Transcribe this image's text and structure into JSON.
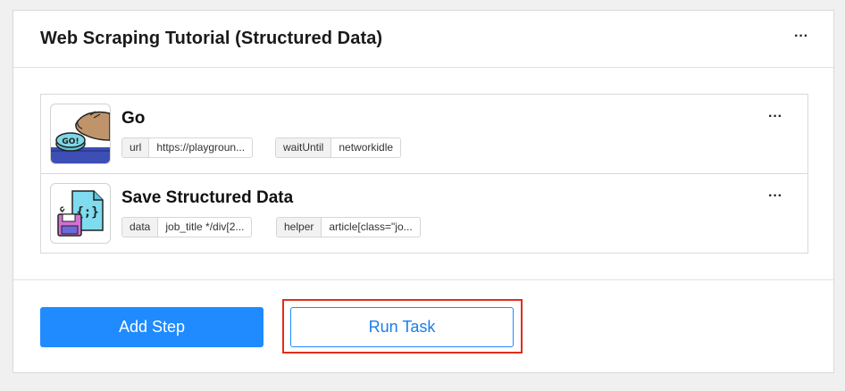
{
  "card": {
    "title": "Web Scraping Tutorial (Structured Data)",
    "menu_label": "···"
  },
  "steps": [
    {
      "title": "Go",
      "icon": "go-button-icon",
      "menu_label": "···",
      "params": [
        {
          "key": "url",
          "value": "https://playgroun..."
        },
        {
          "key": "waitUntil",
          "value": "networkidle"
        }
      ]
    },
    {
      "title": "Save Structured Data",
      "icon": "save-data-icon",
      "menu_label": "···",
      "params": [
        {
          "key": "data",
          "value": "job_title */div[2..."
        },
        {
          "key": "helper",
          "value": "article[class=\"jo..."
        }
      ]
    }
  ],
  "actions": {
    "add_step": "Add Step",
    "run_task": "Run Task"
  },
  "colors": {
    "primary": "#1f8bff",
    "highlight": "#e02d1b"
  }
}
